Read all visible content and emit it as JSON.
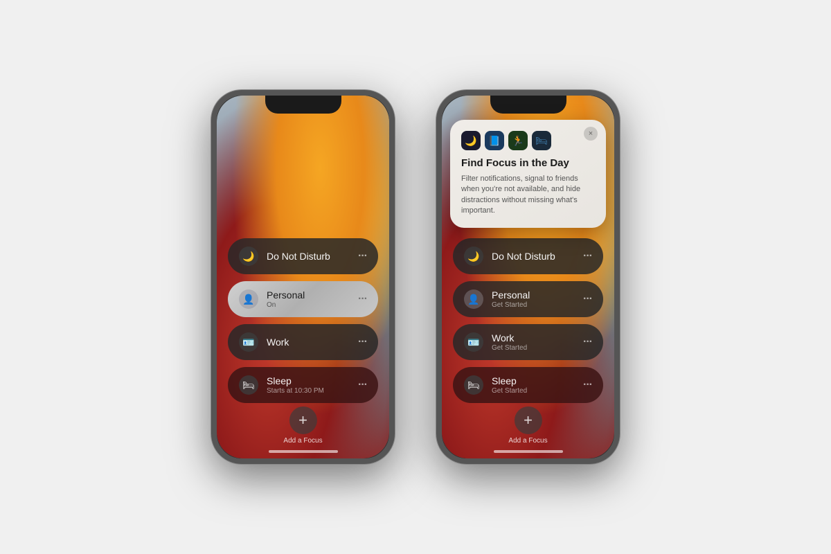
{
  "page": {
    "background": "#f0f0f0"
  },
  "phone1": {
    "items": [
      {
        "id": "do-not-disturb",
        "icon": "🌙",
        "iconType": "moon",
        "title": "Do Not Disturb",
        "subtitle": "",
        "style": "dark",
        "dotsColor": "dark-dots"
      },
      {
        "id": "personal",
        "icon": "👤",
        "iconType": "person-active",
        "title": "Personal",
        "subtitle": "On",
        "style": "active",
        "dotsColor": "light-dots"
      },
      {
        "id": "work",
        "icon": "🪪",
        "iconType": "briefcase",
        "title": "Work",
        "subtitle": "",
        "style": "dark",
        "dotsColor": "dark-dots"
      },
      {
        "id": "sleep",
        "icon": "🛏",
        "iconType": "bed",
        "title": "Sleep",
        "subtitle": "Starts at 10:30 PM",
        "style": "sleep",
        "dotsColor": "dark-dots"
      }
    ],
    "addFocusLabel": "Add a Focus"
  },
  "phone2": {
    "popup": {
      "title": "Find Focus in the Day",
      "description": "Filter notifications, signal to friends when you're not available, and hide distractions without missing what's important.",
      "icons": [
        "🌙",
        "📘",
        "🏃",
        "🛏"
      ],
      "closeLabel": "×"
    },
    "items": [
      {
        "id": "do-not-disturb",
        "icon": "🌙",
        "iconType": "moon",
        "title": "Do Not Disturb",
        "subtitle": "",
        "style": "dark",
        "dotsColor": "dark-dots"
      },
      {
        "id": "personal",
        "icon": "👤",
        "iconType": "person",
        "title": "Personal",
        "subtitle": "Get Started",
        "style": "dark",
        "dotsColor": "dark-dots"
      },
      {
        "id": "work",
        "icon": "🪪",
        "iconType": "briefcase",
        "title": "Work",
        "subtitle": "Get Started",
        "style": "dark",
        "dotsColor": "dark-dots"
      },
      {
        "id": "sleep",
        "icon": "🛏",
        "iconType": "bed",
        "title": "Sleep",
        "subtitle": "Get Started",
        "style": "sleep",
        "dotsColor": "dark-dots"
      }
    ],
    "addFocusLabel": "Add a Focus"
  }
}
